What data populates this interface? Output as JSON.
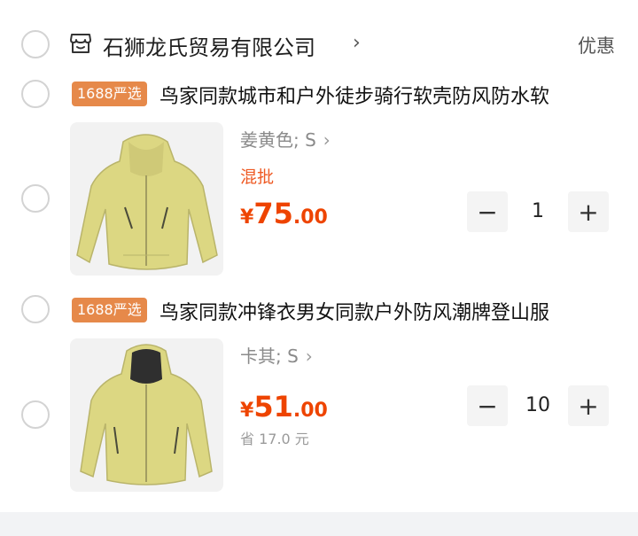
{
  "store": {
    "name": "石狮龙氏贸易有限公司",
    "chevron": "›",
    "coupon_label": "优惠",
    "icon": "store-icon"
  },
  "items": [
    {
      "badge": "1688严选",
      "title": "鸟家同款城市和户外徒步骑行软壳防风防水软",
      "spec": "姜黄色; S",
      "spec_chevron": "›",
      "tag": "混批",
      "price_currency": "¥",
      "price_int": "75",
      "price_dec": ".00",
      "quantity": "1",
      "minus": "−",
      "plus": "+"
    },
    {
      "badge": "1688严选",
      "title": "鸟家同款冲锋衣男女同款户外防风潮牌登山服",
      "spec": "卡其; S",
      "spec_chevron": "›",
      "price_currency": "¥",
      "price_int": "51",
      "price_dec": ".00",
      "saving": "省 17.0 元",
      "quantity": "10",
      "minus": "−",
      "plus": "+"
    }
  ],
  "colors": {
    "accent": "#ee4400",
    "badge": "#e6894a",
    "jacket": "#dcd782"
  }
}
